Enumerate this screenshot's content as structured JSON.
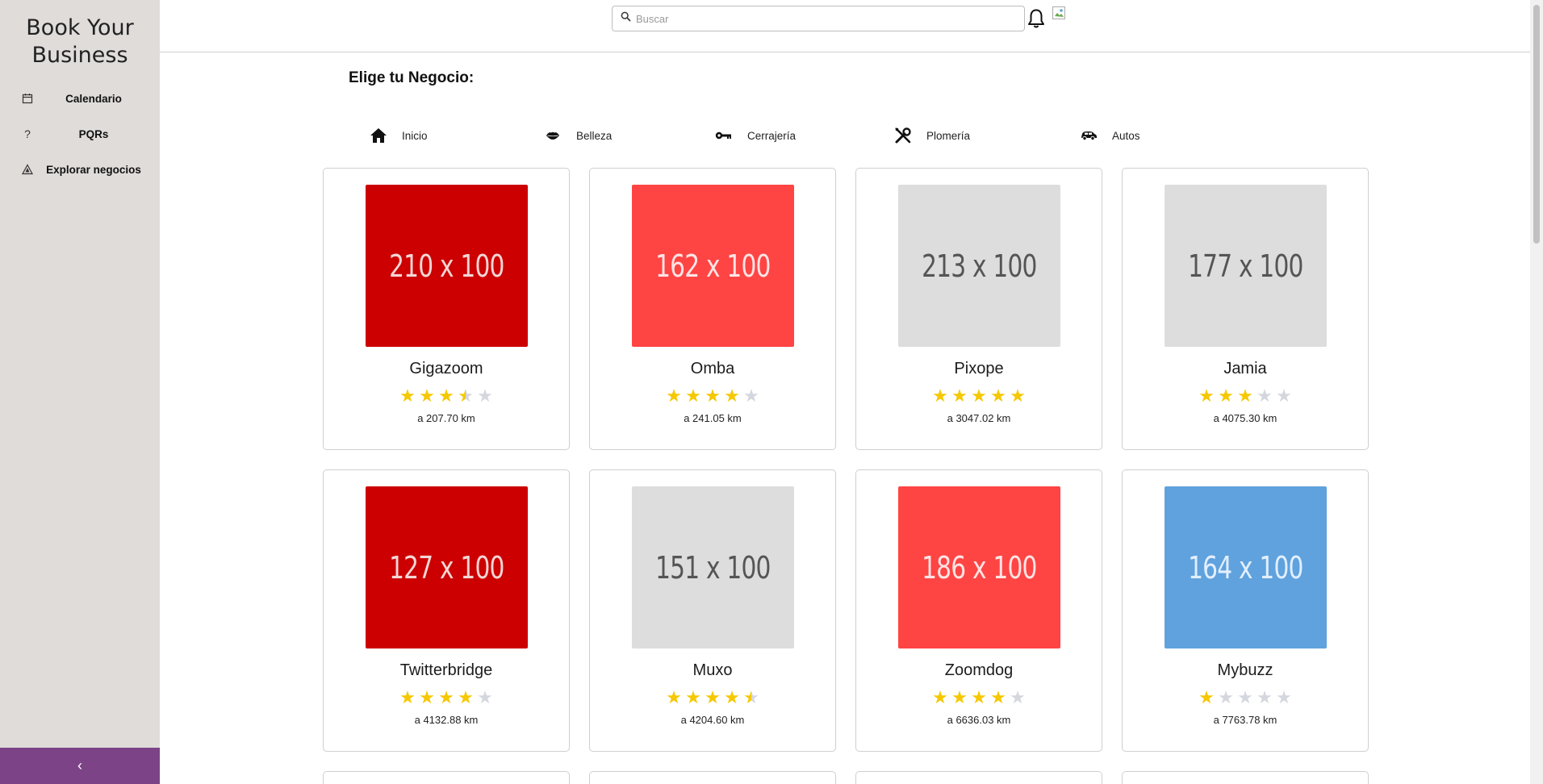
{
  "sidebar": {
    "brand_line1": "Book Your",
    "brand_line2": "Business",
    "items": [
      {
        "label": "Calendario",
        "icon": "calendar-icon"
      },
      {
        "label": "PQRs",
        "icon": "question-icon"
      },
      {
        "label": "Explorar negocios",
        "icon": "compass-icon"
      }
    ],
    "collapse_symbol": "‹"
  },
  "header": {
    "search_placeholder": "Buscar"
  },
  "main": {
    "heading": "Elige tu Negocio:",
    "categories": [
      {
        "label": "Inicio",
        "icon": "home-icon"
      },
      {
        "label": "Belleza",
        "icon": "lips-icon"
      },
      {
        "label": "Cerrajería",
        "icon": "key-icon"
      },
      {
        "label": "Plomería",
        "icon": "tools-icon"
      },
      {
        "label": "Autos",
        "icon": "car-icon"
      }
    ],
    "businesses": [
      {
        "name": "Gigazoom",
        "thumb_text": "210 x 100",
        "thumb_bg": "#cc0000",
        "thumb_fg": "#f4d6d6",
        "rating": 3.5,
        "distance": "a 207.70 km"
      },
      {
        "name": "Omba",
        "thumb_text": "162 x 100",
        "thumb_bg": "#ff4444",
        "thumb_fg": "#ffe4e4",
        "rating": 4,
        "distance": "a 241.05 km"
      },
      {
        "name": "Pixope",
        "thumb_text": "213 x 100",
        "thumb_bg": "#dddddd",
        "thumb_fg": "#555555",
        "rating": 5,
        "distance": "a 3047.02 km"
      },
      {
        "name": "Jamia",
        "thumb_text": "177 x 100",
        "thumb_bg": "#dddddd",
        "thumb_fg": "#555555",
        "rating": 3,
        "distance": "a 4075.30 km"
      },
      {
        "name": "Twitterbridge",
        "thumb_text": "127 x 100",
        "thumb_bg": "#cc0000",
        "thumb_fg": "#f4d6d6",
        "rating": 4,
        "distance": "a 4132.88 km"
      },
      {
        "name": "Muxo",
        "thumb_text": "151 x 100",
        "thumb_bg": "#dddddd",
        "thumb_fg": "#555555",
        "rating": 4.5,
        "distance": "a 4204.60 km"
      },
      {
        "name": "Zoomdog",
        "thumb_text": "186 x 100",
        "thumb_bg": "#ff4444",
        "thumb_fg": "#ffe4e4",
        "rating": 4,
        "distance": "a 6636.03 km"
      },
      {
        "name": "Mybuzz",
        "thumb_text": "164 x 100",
        "thumb_bg": "#5fa2dd",
        "thumb_fg": "#e2efff",
        "rating": 1,
        "distance": "a 7763.78 km"
      }
    ]
  },
  "colors": {
    "sidebar_bg": "#e0dcda",
    "collapse_bg": "#7d4387",
    "star_on": "#f5c800",
    "star_off": "#d5d7de"
  }
}
